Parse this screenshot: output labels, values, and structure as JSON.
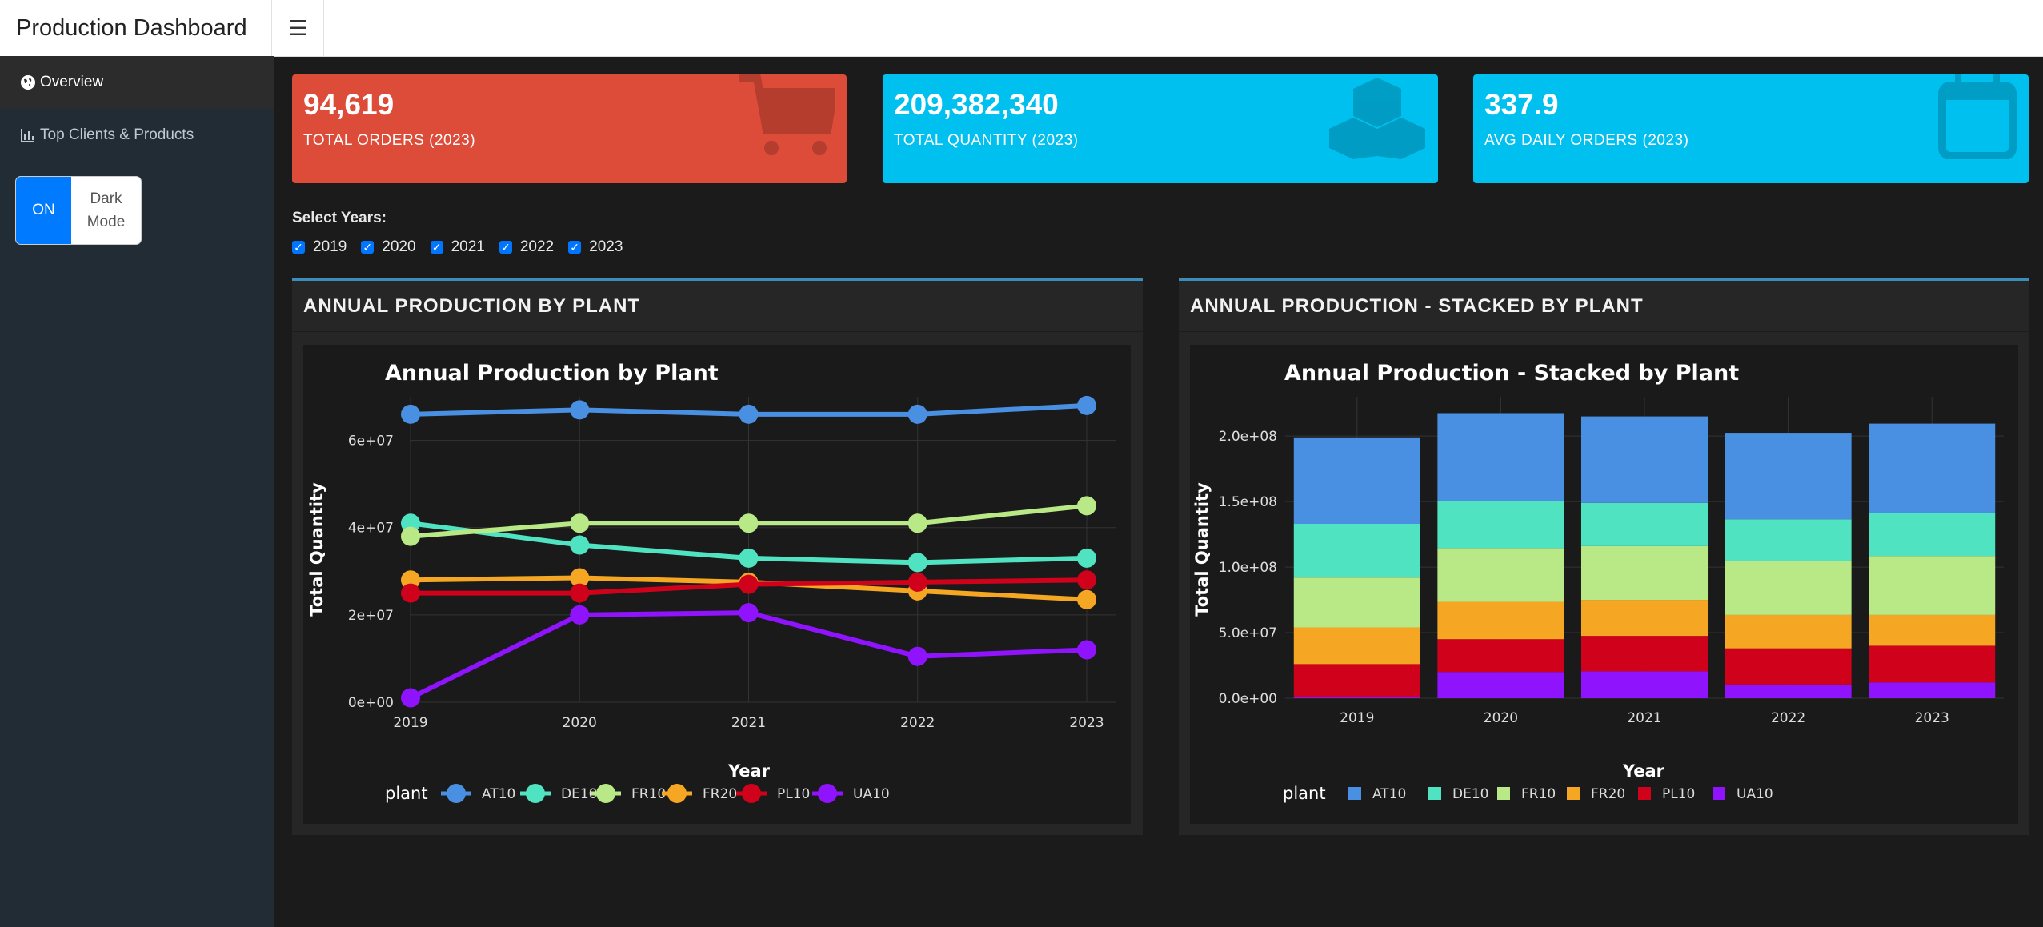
{
  "header": {
    "title": "Production Dashboard",
    "menu_icon": "hamburger-icon"
  },
  "sidebar": {
    "items": [
      {
        "label": "Overview",
        "icon": "globe-icon",
        "active": true
      },
      {
        "label": "Top Clients & Products",
        "icon": "chart-icon",
        "active": false
      }
    ],
    "dark_mode": {
      "state": "ON",
      "label_line1": "Dark",
      "label_line2": "Mode"
    }
  },
  "value_boxes": [
    {
      "value": "94,619",
      "caption": "TOTAL ORDERS (2023)",
      "color": "#dd4b39",
      "icon": "cart-icon"
    },
    {
      "value": "209,382,340",
      "caption": "TOTAL QUANTITY (2023)",
      "color": "#00c0ef",
      "icon": "cubes-icon"
    },
    {
      "value": "337.9",
      "caption": "AVG DAILY ORDERS (2023)",
      "color": "#00c0ef",
      "icon": "calendar-icon"
    }
  ],
  "year_filter": {
    "title": "Select Years:",
    "options": [
      {
        "label": "2019",
        "checked": true
      },
      {
        "label": "2020",
        "checked": true
      },
      {
        "label": "2021",
        "checked": true
      },
      {
        "label": "2022",
        "checked": true
      },
      {
        "label": "2023",
        "checked": true
      }
    ]
  },
  "cards": [
    {
      "title": "ANNUAL PRODUCTION BY PLANT"
    },
    {
      "title": "ANNUAL PRODUCTION - STACKED BY PLANT"
    }
  ],
  "colors": {
    "AT10": "#4a90e2",
    "DE10": "#50e3c2",
    "FR10": "#b8e986",
    "FR20": "#f5a623",
    "PL10": "#d0021b",
    "UA10": "#9013fe"
  },
  "chart_data": [
    {
      "type": "line",
      "title": "Annual Production by Plant",
      "xlabel": "Year",
      "ylabel": "Total Quantity",
      "x": [
        2019,
        2020,
        2021,
        2022,
        2023
      ],
      "ylim": [
        0,
        70000000
      ],
      "yticks": [
        0,
        20000000,
        40000000,
        60000000
      ],
      "ytick_labels": [
        "0e+00",
        "2e+07",
        "4e+07",
        "6e+07"
      ],
      "legend_title": "plant",
      "legend_position": "bottom",
      "grid": true,
      "series": [
        {
          "name": "AT10",
          "values": [
            66000000,
            67000000,
            66000000,
            66000000,
            68000000
          ]
        },
        {
          "name": "DE10",
          "values": [
            41000000,
            36000000,
            33000000,
            32000000,
            33000000
          ]
        },
        {
          "name": "FR10",
          "values": [
            38000000,
            41000000,
            41000000,
            41000000,
            45000000
          ]
        },
        {
          "name": "FR20",
          "values": [
            28000000,
            28500000,
            27500000,
            25500000,
            23500000
          ]
        },
        {
          "name": "PL10",
          "values": [
            25000000,
            25000000,
            27000000,
            27500000,
            28000000
          ]
        },
        {
          "name": "UA10",
          "values": [
            1000000,
            20000000,
            20500000,
            10500000,
            12000000
          ]
        }
      ]
    },
    {
      "type": "bar",
      "stacked": true,
      "title": "Annual Production - Stacked by Plant",
      "xlabel": "Year",
      "ylabel": "Total Quantity",
      "categories": [
        "2019",
        "2020",
        "2021",
        "2022",
        "2023"
      ],
      "ylim": [
        0,
        230000000
      ],
      "yticks": [
        0,
        50000000,
        100000000,
        150000000,
        200000000
      ],
      "ytick_labels": [
        "0.0e+00",
        "5.0e+07",
        "1.0e+08",
        "1.5e+08",
        "2.0e+08"
      ],
      "legend_title": "plant",
      "legend_position": "bottom",
      "grid": true,
      "series": [
        {
          "name": "UA10",
          "values": [
            1000000,
            20000000,
            20500000,
            10500000,
            12000000
          ]
        },
        {
          "name": "PL10",
          "values": [
            25000000,
            25000000,
            27000000,
            27500000,
            28000000
          ]
        },
        {
          "name": "FR20",
          "values": [
            28000000,
            28500000,
            27500000,
            25500000,
            23500000
          ]
        },
        {
          "name": "FR10",
          "values": [
            38000000,
            41000000,
            41000000,
            41000000,
            45000000
          ]
        },
        {
          "name": "DE10",
          "values": [
            41000000,
            36000000,
            33000000,
            32000000,
            33000000
          ]
        },
        {
          "name": "AT10",
          "values": [
            66000000,
            67000000,
            66000000,
            66000000,
            68000000
          ]
        }
      ]
    }
  ]
}
